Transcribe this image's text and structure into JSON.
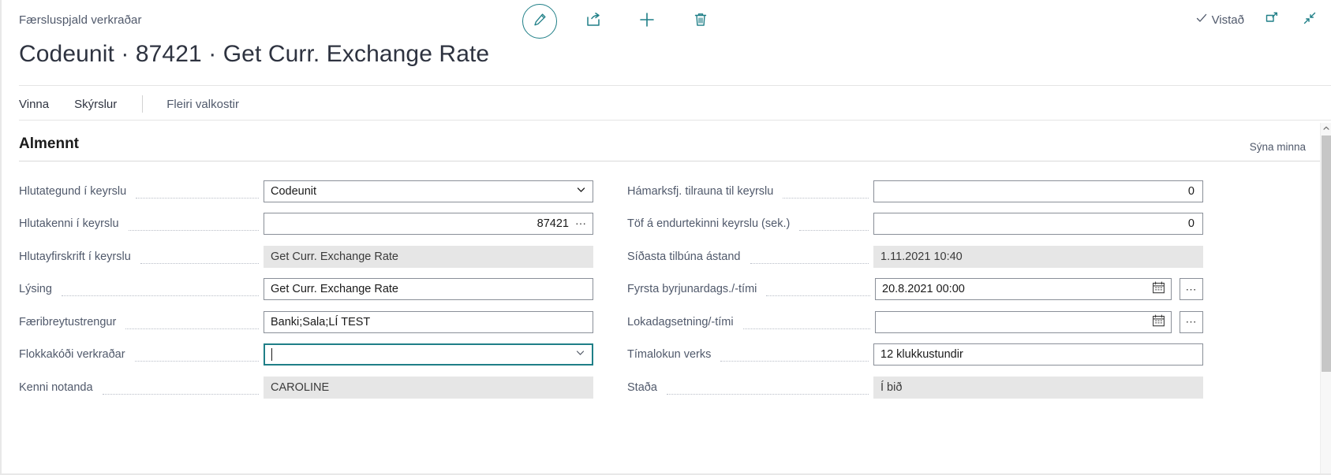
{
  "header": {
    "breadcrumb": "Færsluspjald verkraðar",
    "title": "Codeunit · 87421 · Get Curr. Exchange Rate",
    "saved_label": "Vistað",
    "actions": [
      {
        "name": "edit-icon",
        "label": "Edit"
      },
      {
        "name": "share-icon",
        "label": "Share"
      },
      {
        "name": "plus-icon",
        "label": "New"
      },
      {
        "name": "trash-icon",
        "label": "Delete"
      }
    ],
    "window_actions": [
      {
        "name": "open-in-new-window-icon",
        "label": "Open in new window"
      },
      {
        "name": "collapse-icon",
        "label": "Collapse"
      }
    ]
  },
  "menubar": {
    "items": [
      {
        "label": "Vinna"
      },
      {
        "label": "Skýrslur"
      }
    ],
    "more_label": "Fleiri valkostir"
  },
  "section": {
    "title": "Almennt",
    "toggle_label": "Sýna minna"
  },
  "form": {
    "left": [
      {
        "label": "Hlutategund í keyrslu",
        "value": "Codeunit",
        "control": "dropdown",
        "readonly": false,
        "name": "object-type-field"
      },
      {
        "label": "Hlutakenni í keyrslu",
        "value": "87421",
        "control": "lookup",
        "align": "right",
        "readonly": false,
        "name": "object-id-field"
      },
      {
        "label": "Hlutayfirskrift í keyrslu",
        "value": "Get Curr. Exchange Rate",
        "control": "text",
        "readonly": true,
        "name": "object-caption-field"
      },
      {
        "label": "Lýsing",
        "value": "Get Curr. Exchange Rate",
        "control": "text",
        "readonly": false,
        "name": "description-field"
      },
      {
        "label": "Færibreytustrengur",
        "value": "Banki;Sala;LÍ TEST",
        "control": "text",
        "readonly": false,
        "name": "parameter-string-field"
      },
      {
        "label": "Flokkakóði verkraðar",
        "value": "",
        "control": "dropdown",
        "readonly": false,
        "focused": true,
        "name": "job-queue-category-code-field"
      },
      {
        "label": "Kenni notanda",
        "value": "CAROLINE",
        "control": "text",
        "readonly": true,
        "name": "user-id-field"
      }
    ],
    "right": [
      {
        "label": "Hámarksfj. tilrauna til keyrslu",
        "value": "0",
        "control": "text",
        "align": "right",
        "readonly": false,
        "name": "max-attempts-field"
      },
      {
        "label": "Töf á endurtekinni keyrslu (sek.)",
        "value": "0",
        "control": "text",
        "align": "right",
        "readonly": false,
        "name": "rerun-delay-field"
      },
      {
        "label": "Síðasta tilbúna ástand",
        "value": "1.11.2021 10:40",
        "control": "text",
        "readonly": true,
        "name": "last-ready-state-field"
      },
      {
        "label": "Fyrsta byrjunardags./-tími",
        "value": "20.8.2021 00:00",
        "control": "datetime",
        "readonly": false,
        "name": "earliest-start-datetime-field"
      },
      {
        "label": "Lokadagsetning/-tími",
        "value": "",
        "control": "datetime",
        "readonly": false,
        "name": "expiration-datetime-field"
      },
      {
        "label": "Tímalokun verks",
        "value": "12 klukkustundir",
        "control": "text",
        "readonly": false,
        "name": "job-timeout-field"
      },
      {
        "label": "Staða",
        "value": "Í bið",
        "control": "text",
        "readonly": true,
        "name": "status-field"
      }
    ]
  },
  "colors": {
    "accent": "#1f7f87",
    "label": "#50596b",
    "readonly_bg": "#e6e6e6"
  }
}
